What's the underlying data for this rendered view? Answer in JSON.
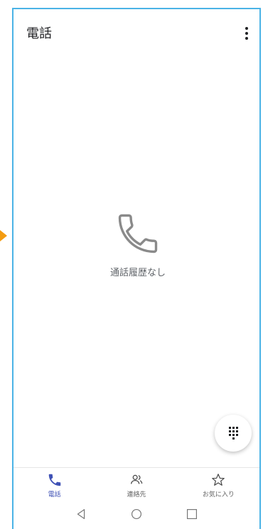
{
  "header": {
    "title": "電話"
  },
  "empty_state": {
    "icon": "phone-icon",
    "message": "通話履歴なし"
  },
  "fab": {
    "icon": "dialpad-icon"
  },
  "bottom_nav": {
    "items": [
      {
        "label": "電話",
        "icon": "phone-icon",
        "active": true
      },
      {
        "label": "連絡先",
        "icon": "contacts-icon",
        "active": false
      },
      {
        "label": "お気に入り",
        "icon": "star-icon",
        "active": false
      }
    ]
  },
  "system_nav": {
    "buttons": [
      "back",
      "home",
      "recents"
    ]
  },
  "colors": {
    "accent": "#3f51b5",
    "frame_border": "#4ab3e6",
    "side_marker": "#f39c12"
  }
}
